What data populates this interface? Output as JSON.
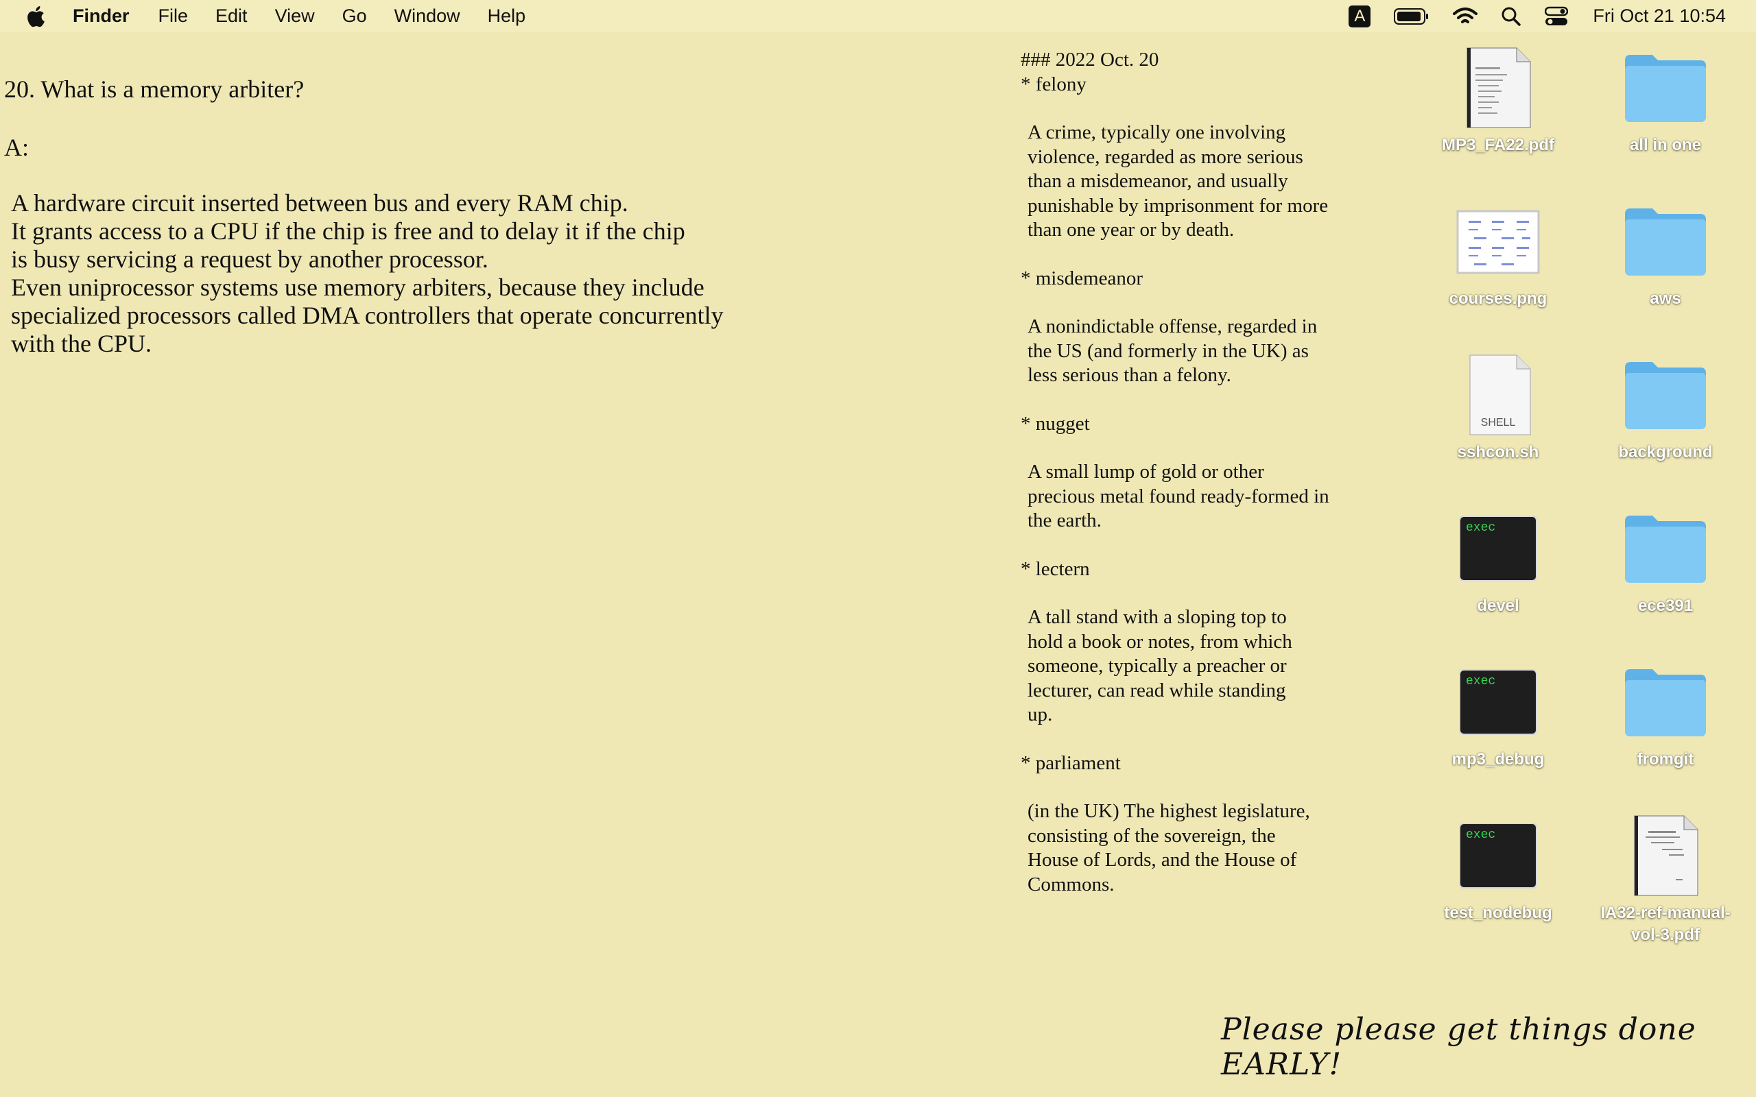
{
  "menubar": {
    "app_name": "Finder",
    "items": [
      "File",
      "Edit",
      "View",
      "Go",
      "Window",
      "Help"
    ],
    "input_source": "A",
    "clock": "Fri Oct 21  10:54"
  },
  "note_left": {
    "question": "20. What is a memory arbiter?",
    "answer_label": "A:",
    "answer": "A hardware circuit inserted between bus and every RAM chip.\nIt grants access to a CPU if the chip is free and to delay it if the chip\nis busy servicing a request by another processor.\nEven uniprocessor systems use memory arbiters, because they include\nspecialized processors called DMA controllers that operate concurrently\nwith the CPU."
  },
  "note_vocab": {
    "heading": "### 2022 Oct. 20",
    "entries": [
      {
        "term": "* felony",
        "definition": "A crime, typically one involving\nviolence, regarded as more serious\nthan a misdemeanor, and usually\npunishable by imprisonment for more\nthan one year or by death."
      },
      {
        "term": "* misdemeanor",
        "definition": "A nonindictable offense, regarded in\nthe US (and formerly in the UK) as\nless serious than a felony."
      },
      {
        "term": "* nugget",
        "definition": "A small lump of gold or other\nprecious metal found ready-formed in\nthe earth."
      },
      {
        "term": "* lectern",
        "definition": "A tall stand with a sloping top to\nhold a book or notes, from which\nsomeone, typically a preacher or\nlecturer, can read while standing\nup."
      },
      {
        "term": "* parliament",
        "definition": "(in the UK) The highest legislature,\nconsisting of the sovereign, the\nHouse of Lords, and the House of\nCommons."
      }
    ]
  },
  "desktop_icons": [
    {
      "label": "MP3_FA22.pdf",
      "kind": "pdf-icon"
    },
    {
      "label": "all in one",
      "kind": "folder-icon"
    },
    {
      "label": "courses.png",
      "kind": "image-icon"
    },
    {
      "label": "aws",
      "kind": "folder-icon"
    },
    {
      "label": "sshcon.sh",
      "kind": "shell-script-icon",
      "badge": "SHELL"
    },
    {
      "label": "background",
      "kind": "folder-icon"
    },
    {
      "label": "devel",
      "kind": "exec-icon",
      "badge": "exec"
    },
    {
      "label": "ece391",
      "kind": "folder-icon"
    },
    {
      "label": "mp3_debug",
      "kind": "exec-icon",
      "badge": "exec"
    },
    {
      "label": "fromgit",
      "kind": "folder-icon"
    },
    {
      "label": "test_nodebug",
      "kind": "exec-icon",
      "badge": "exec"
    },
    {
      "label": "IA32-ref-manual-vol-3.pdf",
      "kind": "pdf-icon"
    }
  ],
  "signature": "Please please get things done EARLY!",
  "colors": {
    "desktop_bg": "#efe8b5",
    "folder_blue": "#7cc6f2",
    "exec_bg": "#1e1e1e",
    "exec_text": "#39d353"
  }
}
